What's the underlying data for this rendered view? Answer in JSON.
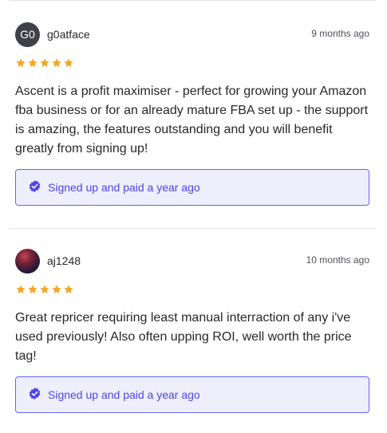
{
  "reviews": [
    {
      "avatar_initials": "G0",
      "username": "g0atface",
      "date": "9 months ago",
      "rating": 5,
      "body": "Ascent is a profit maximiser - perfect for growing your Amazon fba business or for an already mature FBA set up - the support is amazing, the features outstanding and you will benefit greatly from signing up!",
      "verified_text": "Signed up and paid a year ago"
    },
    {
      "avatar_initials": "",
      "username": "aj1248",
      "date": "10 months ago",
      "rating": 5,
      "body": "Great repricer requiring least manual interraction of any i've used previously! Also often upping ROI, well worth the price tag!",
      "verified_text": "Signed up and paid a year ago"
    }
  ],
  "colors": {
    "star": "#f5a524",
    "accent": "#4f46e5",
    "badge_bg": "#eeeefc"
  },
  "icons": {
    "star": "star-icon",
    "verified": "verified-check-icon"
  }
}
